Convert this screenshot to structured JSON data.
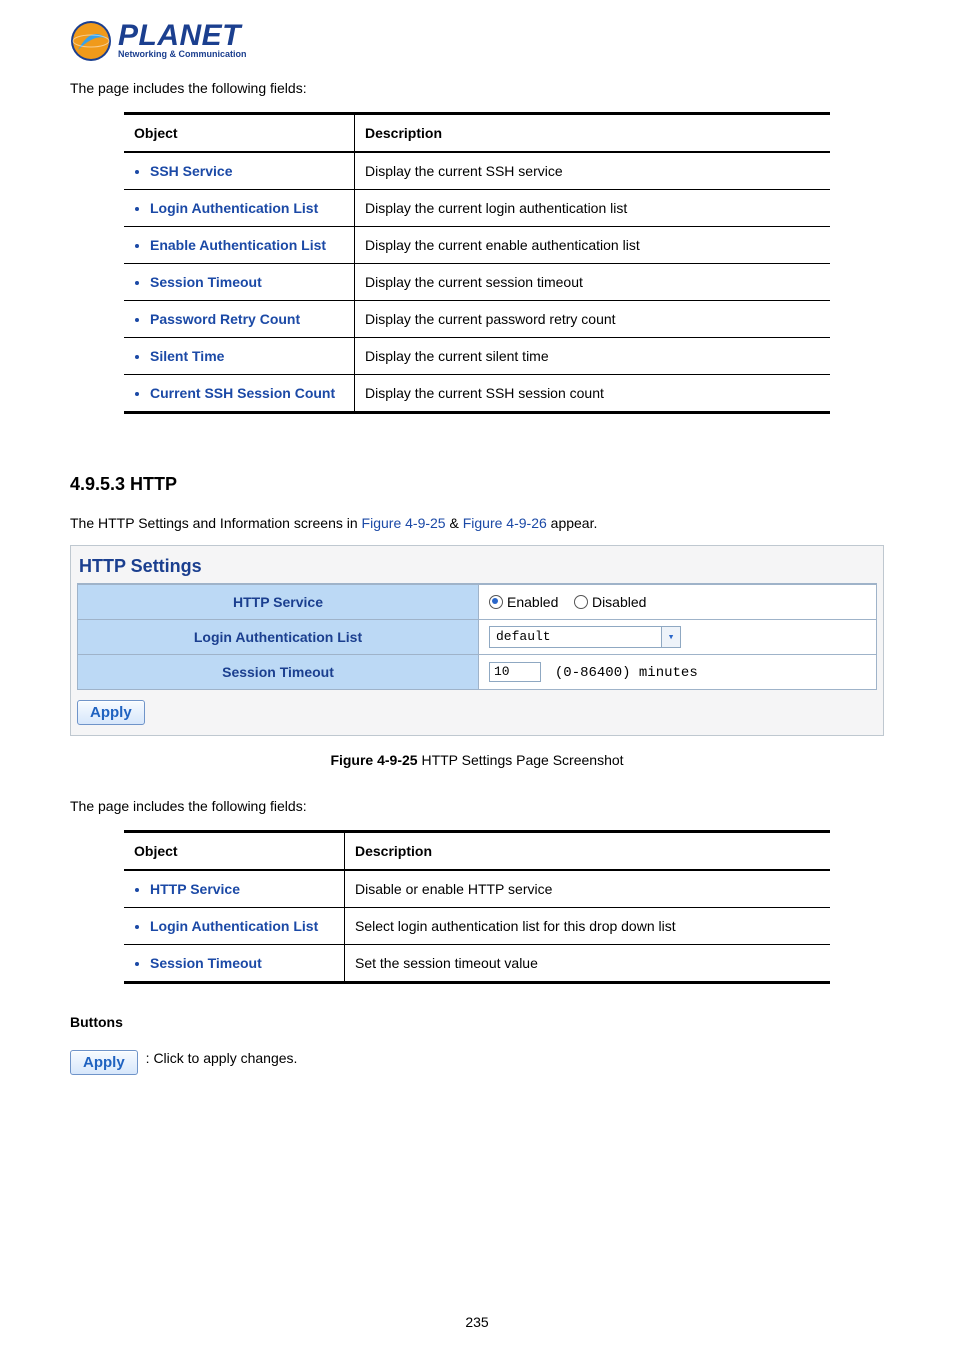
{
  "logo": {
    "brand": "PLANET",
    "tagline": "Networking & Communication"
  },
  "intro_text": "The page includes the following fields:",
  "table1": {
    "headers": {
      "object": "Object",
      "description": "Description"
    },
    "rows": [
      {
        "object": "SSH Service",
        "description": "Display the current SSH service"
      },
      {
        "object": "Login Authentication List",
        "description": "Display the current login authentication list"
      },
      {
        "object": "Enable Authentication List",
        "description": "Display the current enable authentication list"
      },
      {
        "object": "Session Timeout",
        "description": "Display the current session timeout"
      },
      {
        "object": "Password Retry Count",
        "description": "Display the current password retry count"
      },
      {
        "object": "Silent Time",
        "description": "Display the current silent time"
      },
      {
        "object": "Current SSH Session Count",
        "description": "Display the current SSH session count"
      }
    ]
  },
  "section_heading": "4.9.5.3 HTTP",
  "section_sentence": {
    "pre": "The HTTP Settings and Information screens in ",
    "link1": "Figure 4-9-25",
    "amp": " & ",
    "link2": "Figure 4-9-26",
    "post": " appear."
  },
  "http_settings": {
    "title": "HTTP Settings",
    "rows": {
      "service": {
        "label": "HTTP Service",
        "enabled": "Enabled",
        "disabled": "Disabled"
      },
      "login_auth": {
        "label": "Login Authentication List",
        "value": "default"
      },
      "session_timeout": {
        "label": "Session Timeout",
        "value": "10",
        "range": "(0-86400) minutes"
      }
    },
    "apply_label": "Apply"
  },
  "figure_caption": {
    "bold": "Figure 4-9-25",
    "rest": " HTTP Settings Page Screenshot"
  },
  "intro_text2": "The page includes the following fields:",
  "table2": {
    "headers": {
      "object": "Object",
      "description": "Description"
    },
    "rows": [
      {
        "object": "HTTP Service",
        "description": "Disable or enable HTTP service"
      },
      {
        "object": "Login Authentication List",
        "description": "Select login authentication list for this drop down list"
      },
      {
        "object": "Session Timeout",
        "description": "Set the session timeout value"
      }
    ]
  },
  "buttons_heading": "Buttons",
  "buttons_apply_label": "Apply",
  "buttons_apply_desc": ": Click to apply changes.",
  "page_number": "235"
}
